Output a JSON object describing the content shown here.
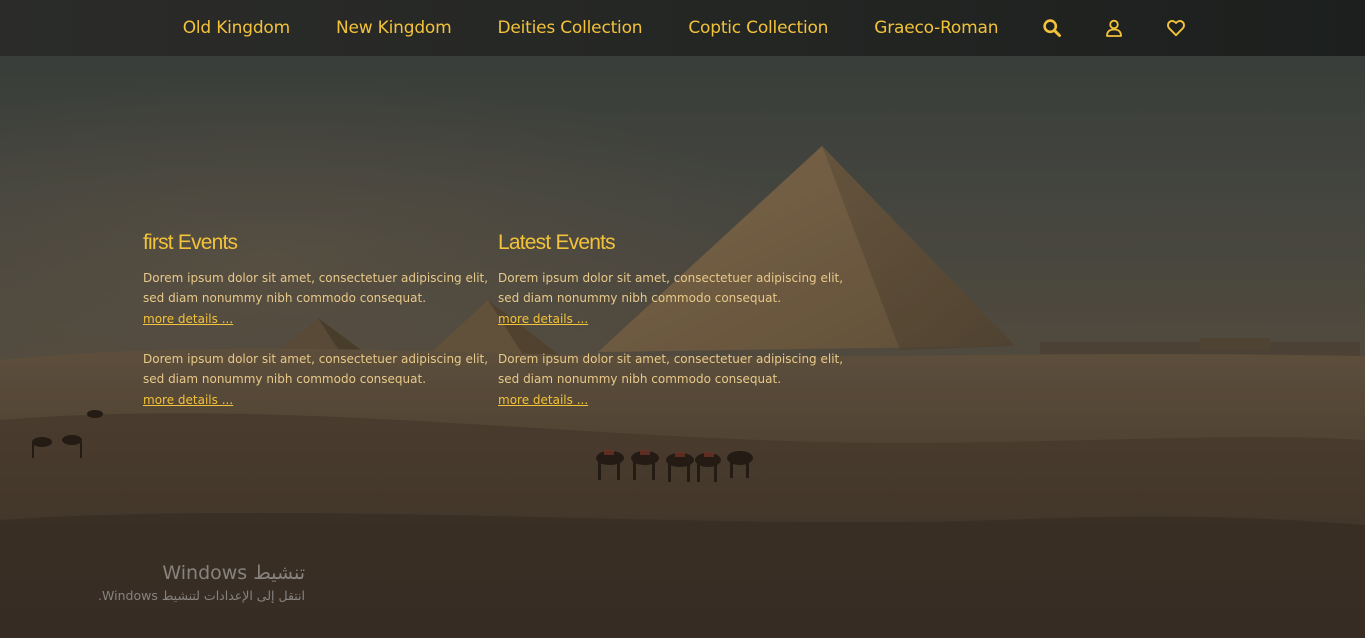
{
  "nav": {
    "items": [
      {
        "label": "Old Kingdom"
      },
      {
        "label": "New Kingdom"
      },
      {
        "label": "Deities Collection"
      },
      {
        "label": "Coptic Collection"
      },
      {
        "label": "Graeco-Roman"
      }
    ],
    "icons": [
      "search-icon",
      "user-icon",
      "heart-icon"
    ],
    "accent_color": "#f2c23a"
  },
  "events": {
    "columns": [
      {
        "title": "first Events",
        "items": [
          {
            "line1": "Dorem ipsum dolor sit amet, consectetuer adipiscing elit,",
            "line2": "sed diam nonummy nibh commodo consequat.",
            "link": "more details ..."
          },
          {
            "line1": "Dorem ipsum dolor sit amet, consectetuer adipiscing elit,",
            "line2": "sed diam nonummy nibh commodo consequat.",
            "link": "more details ..."
          }
        ]
      },
      {
        "title": "Latest Events",
        "items": [
          {
            "line1": "Dorem ipsum dolor sit amet, consectetuer adipiscing elit,",
            "line2": "sed diam nonummy nibh commodo consequat.",
            "link": "more details ..."
          },
          {
            "line1": "Dorem ipsum dolor sit amet, consectetuer adipiscing elit,",
            "line2": "sed diam nonummy nibh commodo consequat.",
            "link": "more details ..."
          }
        ]
      }
    ]
  },
  "watermark": {
    "title": "تنشيط Windows",
    "subtitle": "انتقل إلى الإعدادات لتنشيط Windows."
  }
}
